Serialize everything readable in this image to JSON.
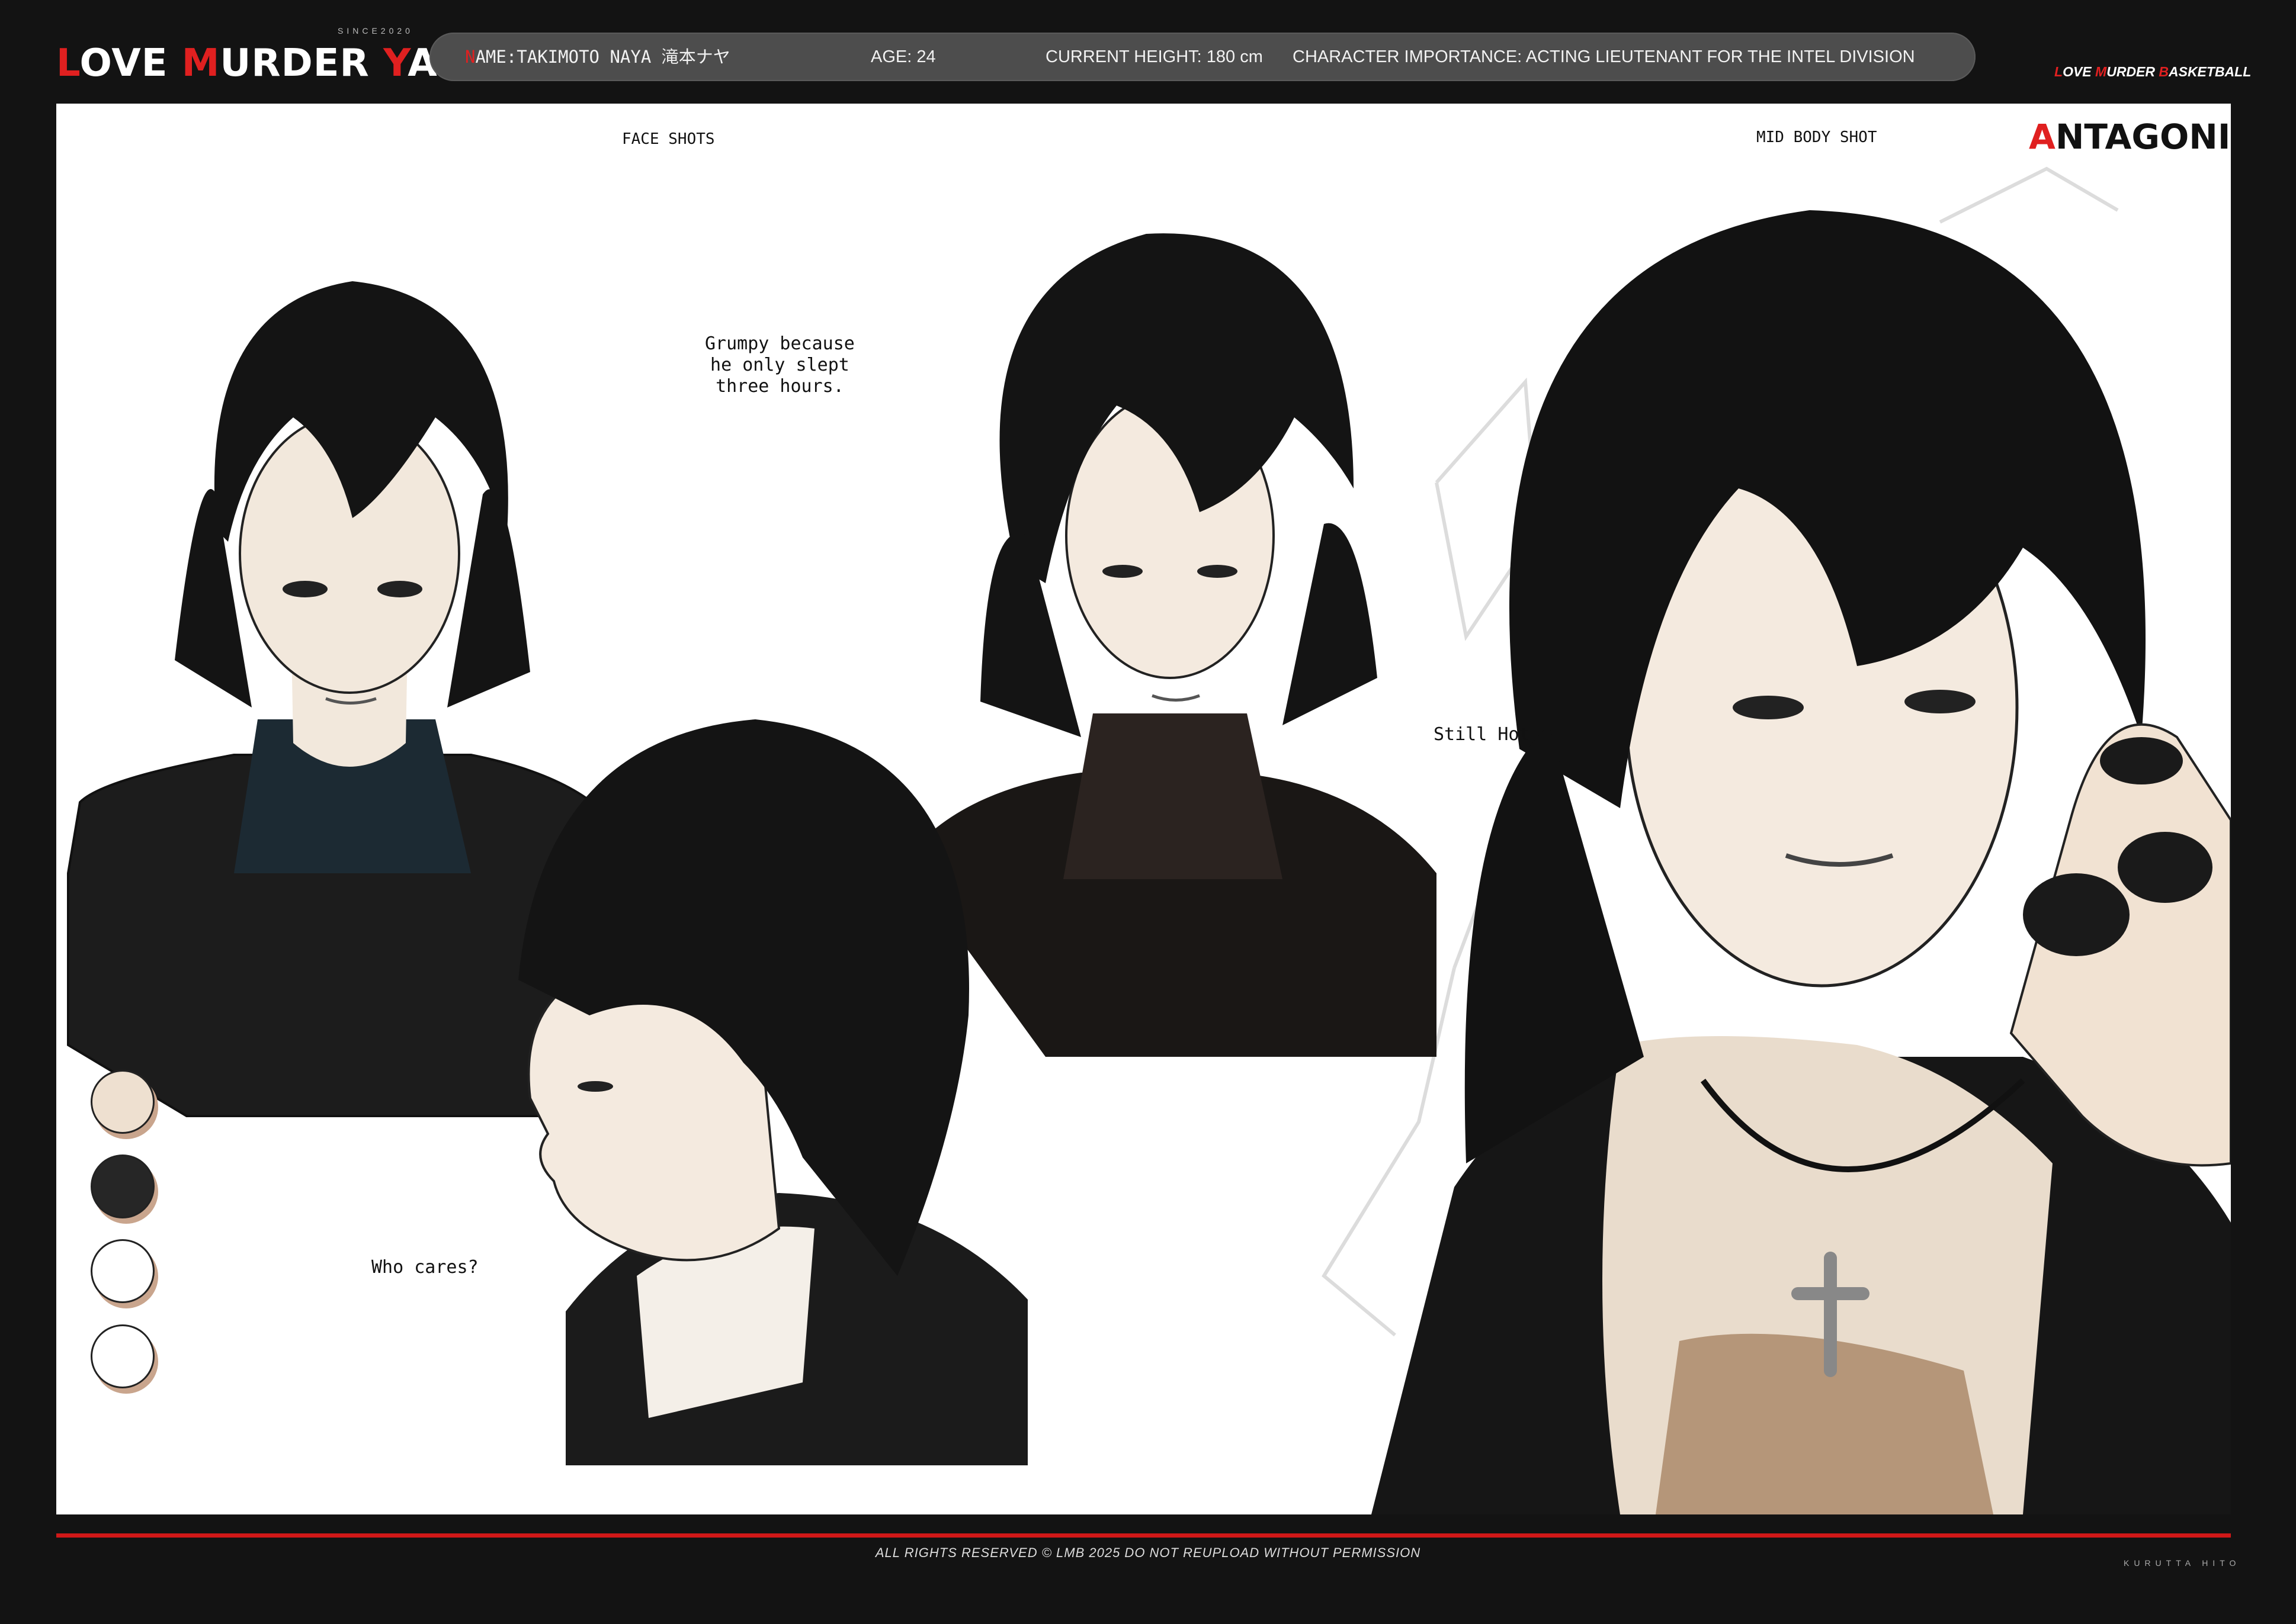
{
  "header": {
    "brand": {
      "w1_first": "L",
      "w1_rest": "OVE ",
      "w2_first": "M",
      "w2_rest": "URDER ",
      "w3_first": "Y",
      "w3_rest": "AKUZA"
    },
    "since": "SINCE2020",
    "name_first": "N",
    "name_rest": "AME:TAKIMOTO NAYA 滝本ナヤ",
    "age": "AGE: 24",
    "height": "CURRENT HEIGHT: 180 cm",
    "importance": "CHARACTER IMPORTANCE: ACTING LIEUTENANT FOR THE INTEL DIVISION",
    "lmb": {
      "w1_first": "L",
      "w1_rest": "OVE ",
      "w2_first": "M",
      "w2_rest": "URDER ",
      "w3_first": "B",
      "w3_rest": "ASKETBALL"
    }
  },
  "sheet": {
    "face_shots_label": "FACE SHOTS",
    "mid_body_label": "MID BODY SHOT",
    "role_first": "A",
    "role_rest": "NTAGONIST",
    "note_grumpy": "Grumpy because\nhe only slept\nthree hours.",
    "note_still_hot": "Still Hot",
    "note_who_cares": "Who cares?"
  },
  "palette": {
    "skin": "#eee0d0",
    "hair": "#262626",
    "white_1": "#ffffff",
    "white_2": "#ffffff",
    "accent_red": "#e02020",
    "shadow_tan": "#c9a58d"
  },
  "footer": {
    "copyright": "ALL RIGHTS RESERVED © LMB 2025 DO NOT REUPLOAD WITHOUT PERMISSION",
    "artist": "KURUTTA HITO"
  }
}
